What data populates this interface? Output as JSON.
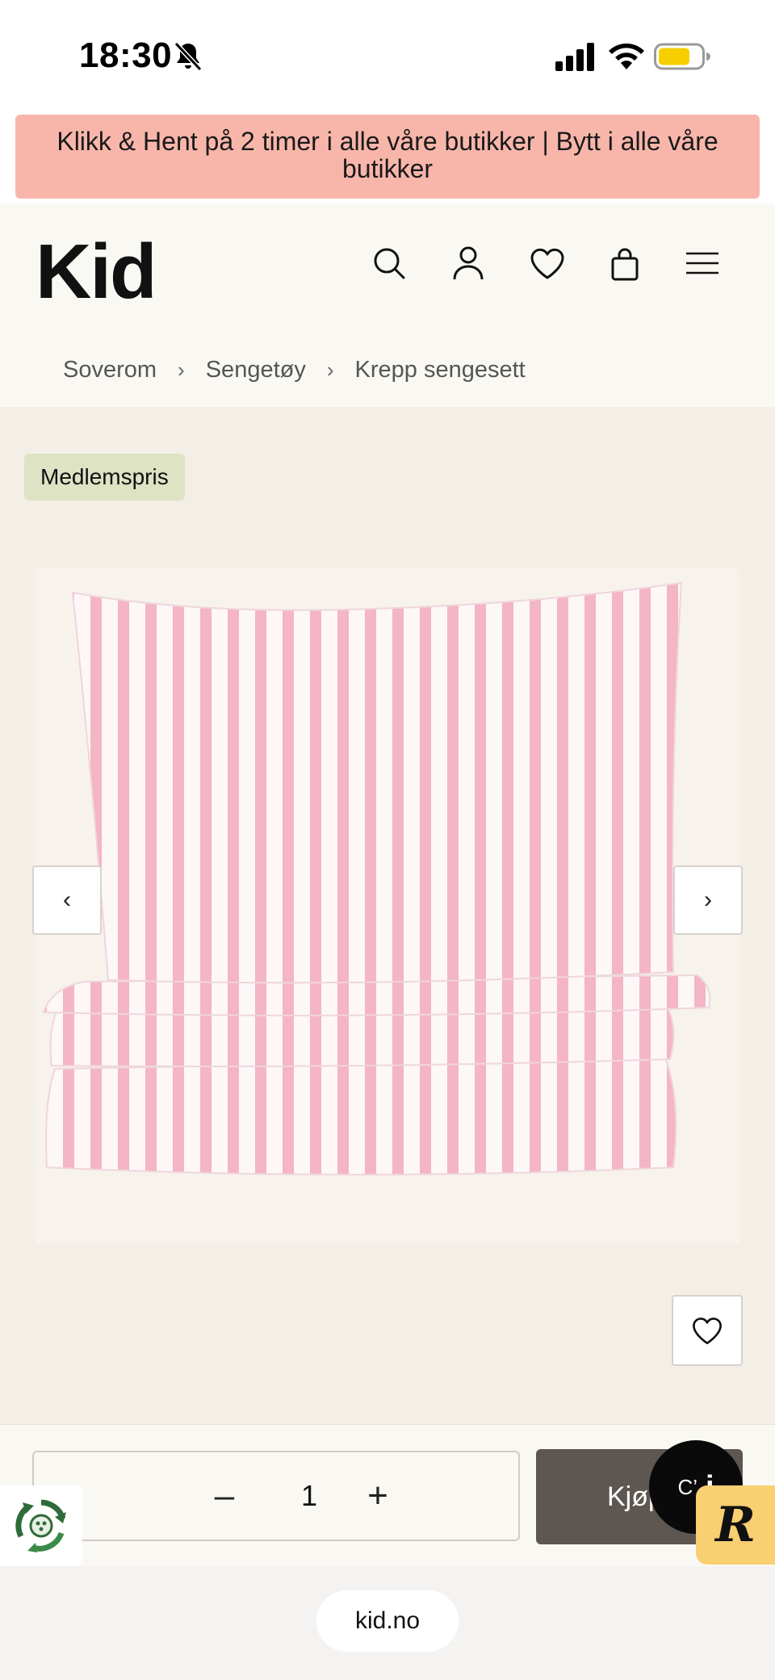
{
  "status_bar": {
    "time": "18:30",
    "icons": [
      "bell-slash-icon",
      "signal-icon",
      "wifi-icon",
      "battery-icon"
    ]
  },
  "announcement": {
    "text": "Klikk & Hent på 2 timer i alle våre butikker | Bytt i alle våre butikker",
    "background": "#f8b6aa"
  },
  "header": {
    "logo": "Kid",
    "icons": [
      "search-icon",
      "account-icon",
      "wishlist-icon",
      "cart-icon",
      "menu-icon"
    ]
  },
  "breadcrumb": {
    "items": [
      "Soverom",
      "Sengetøy",
      "Krepp sengesett"
    ],
    "separator": "›"
  },
  "product": {
    "badge": "Medlemspris",
    "badge_color": "#dde3c3",
    "prev_icon": "‹",
    "next_icon": "›",
    "image_description_icon": "striped-bedding-image",
    "stripe_color": "#f4b5c4"
  },
  "purchase": {
    "minus": "–",
    "quantity": "1",
    "plus": "+",
    "buy_label": "Kjøp",
    "buy_color": "#5e5650"
  },
  "chat": {
    "label": "C’",
    "icon_letter": "i"
  },
  "r_badge": {
    "letter": "R"
  },
  "browser": {
    "url": "kid.no"
  }
}
